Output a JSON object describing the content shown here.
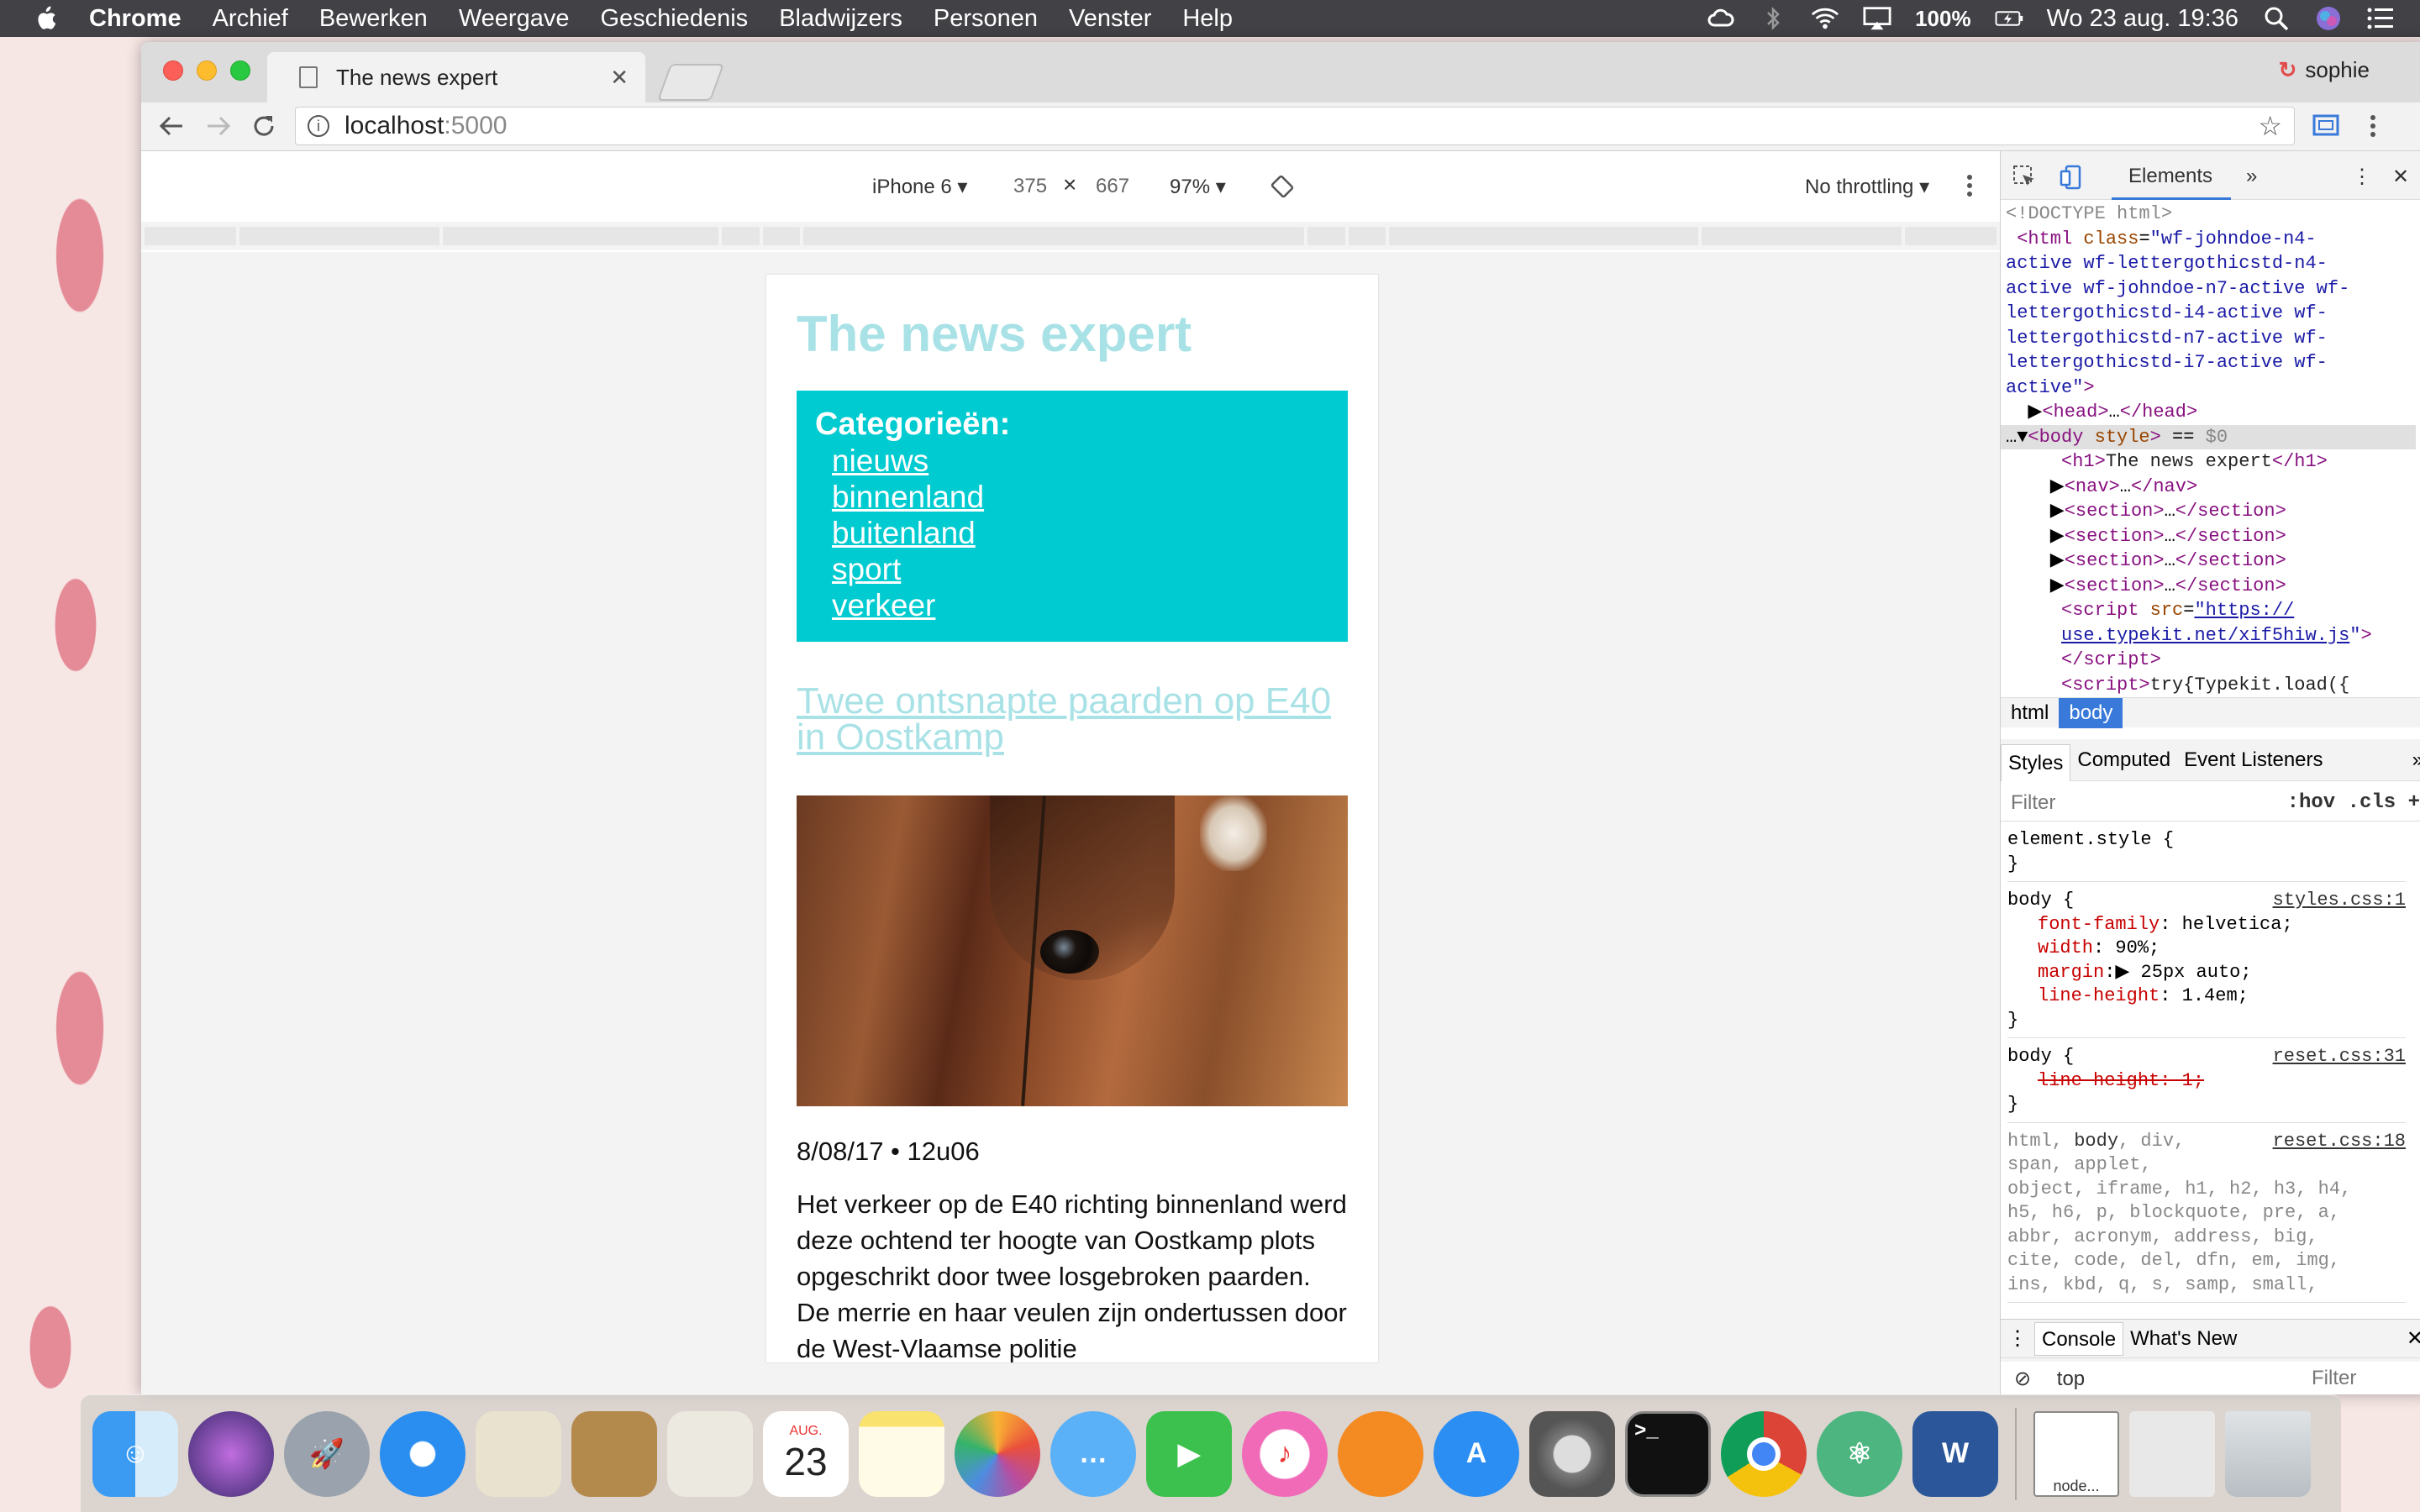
{
  "menubar": {
    "app_name": "Chrome",
    "items": [
      "Archief",
      "Bewerken",
      "Weergave",
      "Geschiedenis",
      "Bladwijzers",
      "Personen",
      "Venster",
      "Help"
    ],
    "battery": "100%",
    "clock": "Wo 23 aug. 19:36"
  },
  "browser": {
    "tab_title": "The news expert",
    "profile_name": "sophie",
    "url_host": "localhost",
    "url_port": ":5000"
  },
  "device_toolbar": {
    "device": "iPhone 6",
    "width": "375",
    "height": "667",
    "times": "×",
    "zoom": "97%",
    "throttling": "No throttling"
  },
  "page": {
    "site_title": "The news expert",
    "categories_heading": "Categorieën:",
    "categories": [
      "nieuws",
      "binnenland",
      "buitenland",
      "sport",
      "verkeer"
    ],
    "article_title": "Twee ontsnapte paarden op E40 in Oostkamp",
    "article_date": "8/08/17 • 12u06",
    "article_body": "Het verkeer op de E40 richting binnenland werd deze ochtend ter hoogte van Oostkamp plots opgeschrikt door twee losgebroken paarden. De merrie en haar veulen zijn ondertussen door de West-Vlaamse politie"
  },
  "devtools": {
    "panel_tab": "Elements",
    "breadcrumbs": [
      "html",
      "body"
    ],
    "style_tabs": [
      "Styles",
      "Computed",
      "Event Listeners"
    ],
    "filter_placeholder": "Filter",
    "filter_hov": ":hov",
    "filter_cls": ".cls",
    "console_tabs": [
      "Console",
      "What's New"
    ],
    "console_context": "top",
    "console_filter": "Filter"
  },
  "dock": {
    "calendar_month": "AUG.",
    "calendar_day": "23",
    "preview_label": "node..."
  },
  "colors": {
    "menubar_bg": "#414146",
    "site_title": "#a9e2e6",
    "category_box": "#00cbd0",
    "devtools_accent": "#3879d9"
  }
}
